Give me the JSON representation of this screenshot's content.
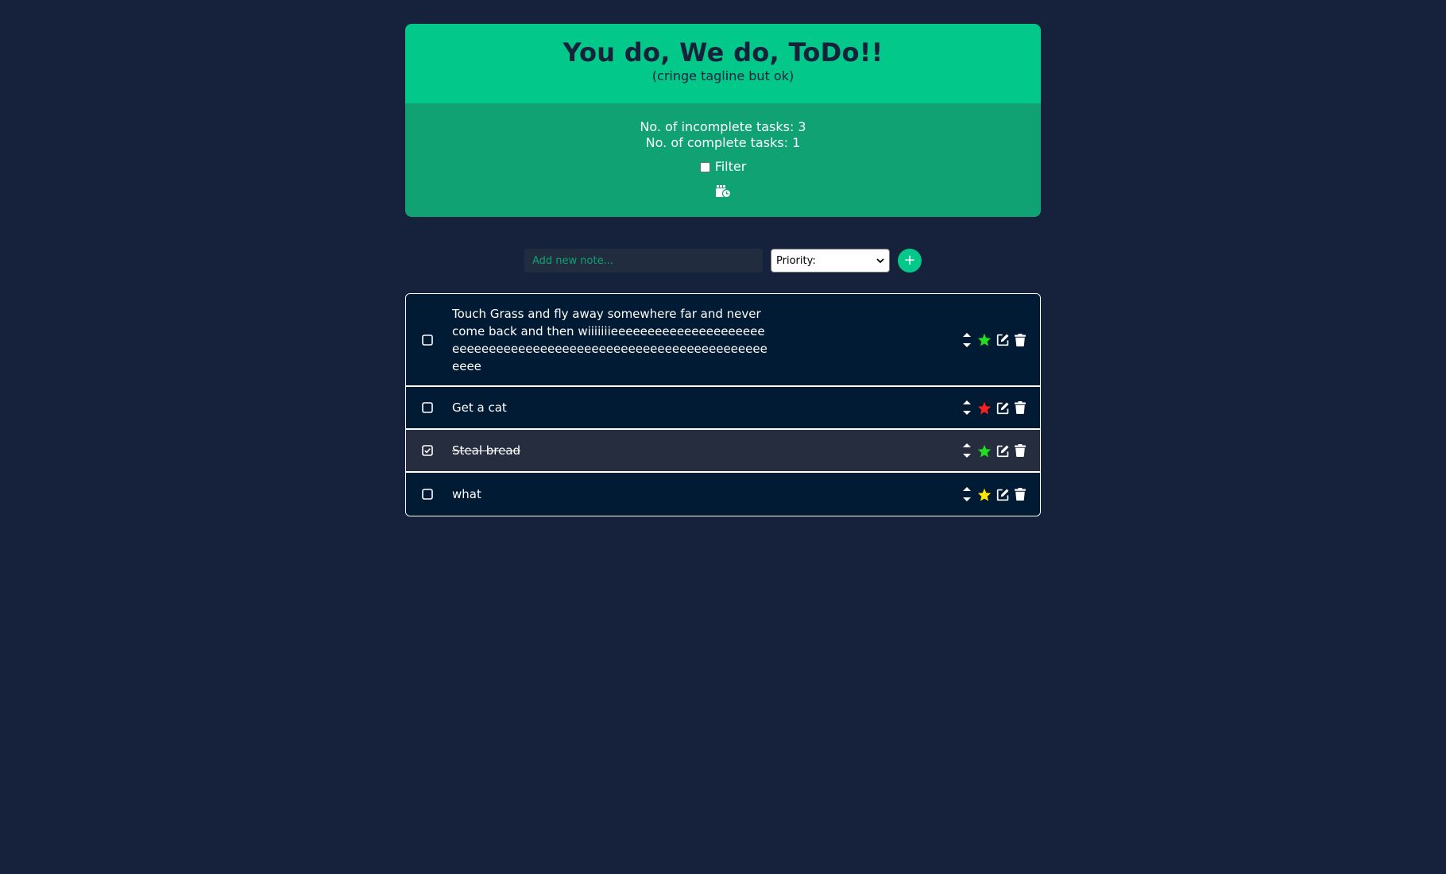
{
  "header": {
    "title": "You do, We do, ToDo!!",
    "tagline": "(cringe tagline but ok)",
    "incomplete_label": "No. of incomplete tasks: 3",
    "complete_label": "No. of complete tasks: 1",
    "filter_label": "Filter",
    "filter_checked": false,
    "clear_icon": "clear-completed-icon"
  },
  "add_form": {
    "placeholder": "Add new note...",
    "priority_selected": "Priority:",
    "add_label": "+"
  },
  "colors": {
    "primary": "#02c88a",
    "primary_dark": "#10a272",
    "background": "#16213b",
    "task_bg": "#001b33",
    "done_bg": "#252d3e",
    "priority_high": "#ff1f1f",
    "priority_medium": "#ffe600",
    "priority_low": "#1fe01f"
  },
  "tasks": [
    {
      "text": "Touch Grass and fly away somewhere far and never come back and then wiiiiiiieeeeeeeeeeeeeeeeeeeeeeeeeeeeeeeeeeeeeeeeeeeeeeeeeeeeeeeeeeeeeeeeeeee",
      "completed": false,
      "priority": "low",
      "star_color": "#1fe01f"
    },
    {
      "text": "Get a cat",
      "completed": false,
      "priority": "high",
      "star_color": "#ff1f1f"
    },
    {
      "text": "Steal bread",
      "completed": true,
      "priority": "low",
      "star_color": "#1fe01f"
    },
    {
      "text": "what",
      "completed": false,
      "priority": "medium",
      "star_color": "#ffe600"
    }
  ]
}
